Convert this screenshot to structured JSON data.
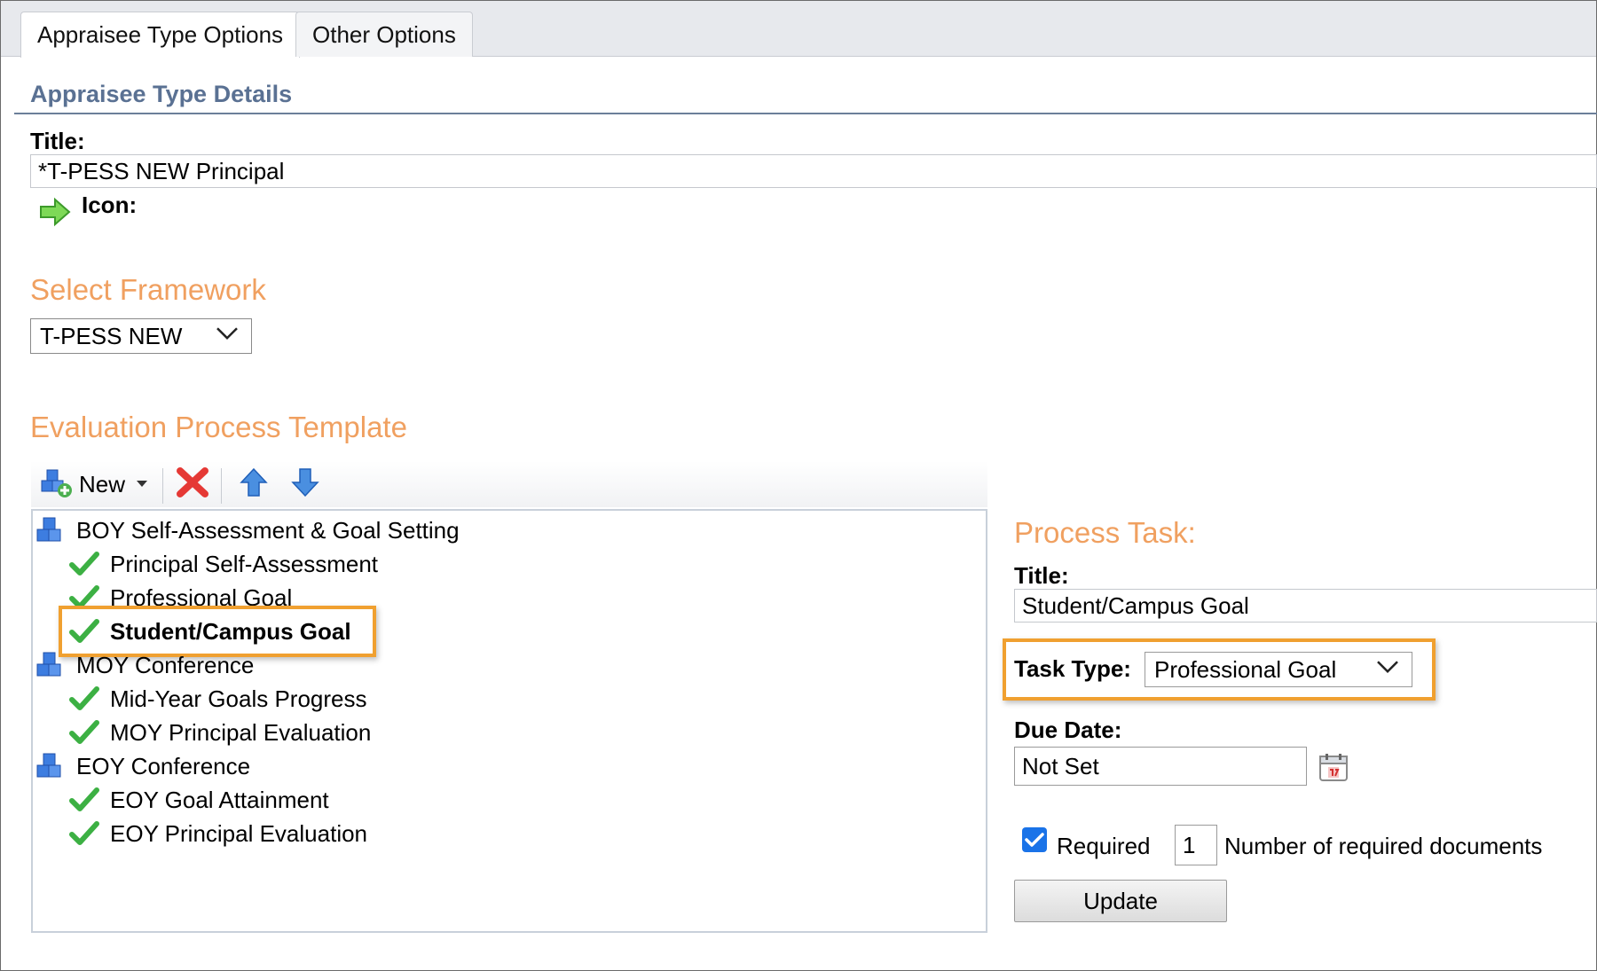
{
  "tabs": [
    {
      "label": "Appraisee Type Options",
      "active": true
    },
    {
      "label": "Other Options",
      "active": false
    }
  ],
  "details": {
    "section_title": "Appraisee Type Details",
    "title_label": "Title:",
    "title_value": "*T-PESS NEW Principal",
    "icon_label": "Icon:",
    "icon_name": "green-arrow-right-icon"
  },
  "framework": {
    "heading": "Select Framework",
    "selected": "T-PESS NEW"
  },
  "template": {
    "heading": "Evaluation Process Template",
    "toolbar": {
      "new_label": "New",
      "icons": [
        "new-blocks-icon",
        "dropdown-caret-icon",
        "delete-icon",
        "move-up-icon",
        "move-down-icon"
      ]
    },
    "tree": [
      {
        "label": "BOY Self-Assessment & Goal Setting",
        "level": 0,
        "icon": "stage-blocks-icon",
        "selected": false
      },
      {
        "label": "Principal Self-Assessment",
        "level": 1,
        "icon": "checkmark-icon",
        "selected": false
      },
      {
        "label": "Professional Goal",
        "level": 1,
        "icon": "checkmark-icon",
        "selected": false
      },
      {
        "label": "Student/Campus Goal",
        "level": 1,
        "icon": "checkmark-icon",
        "selected": true
      },
      {
        "label": "MOY Conference",
        "level": 0,
        "icon": "stage-blocks-icon",
        "selected": false
      },
      {
        "label": "Mid-Year Goals Progress",
        "level": 1,
        "icon": "checkmark-icon",
        "selected": false
      },
      {
        "label": "MOY Principal Evaluation",
        "level": 1,
        "icon": "checkmark-icon",
        "selected": false
      },
      {
        "label": "EOY Conference",
        "level": 0,
        "icon": "stage-blocks-icon",
        "selected": false
      },
      {
        "label": "EOY Goal Attainment",
        "level": 1,
        "icon": "checkmark-icon",
        "selected": false
      },
      {
        "label": "EOY Principal Evaluation",
        "level": 1,
        "icon": "checkmark-icon",
        "selected": false
      }
    ]
  },
  "process_task": {
    "heading": "Process Task:",
    "title_label": "Title:",
    "title_value": "Student/Campus Goal",
    "task_type_label": "Task Type:",
    "task_type_value": "Professional Goal",
    "due_date_label": "Due Date:",
    "due_date_value": "Not Set",
    "calendar_icon": "calendar-icon",
    "required_label": "Required",
    "required_checked": true,
    "num_docs_value": "1",
    "num_docs_label": "Number of required documents",
    "update_label": "Update"
  },
  "colors": {
    "accent_orange": "#f0a060",
    "highlight_orange": "#f0a030",
    "section_blue": "#5a7193",
    "check_green": "#3cb043",
    "checkbox_blue": "#1a73e8"
  }
}
